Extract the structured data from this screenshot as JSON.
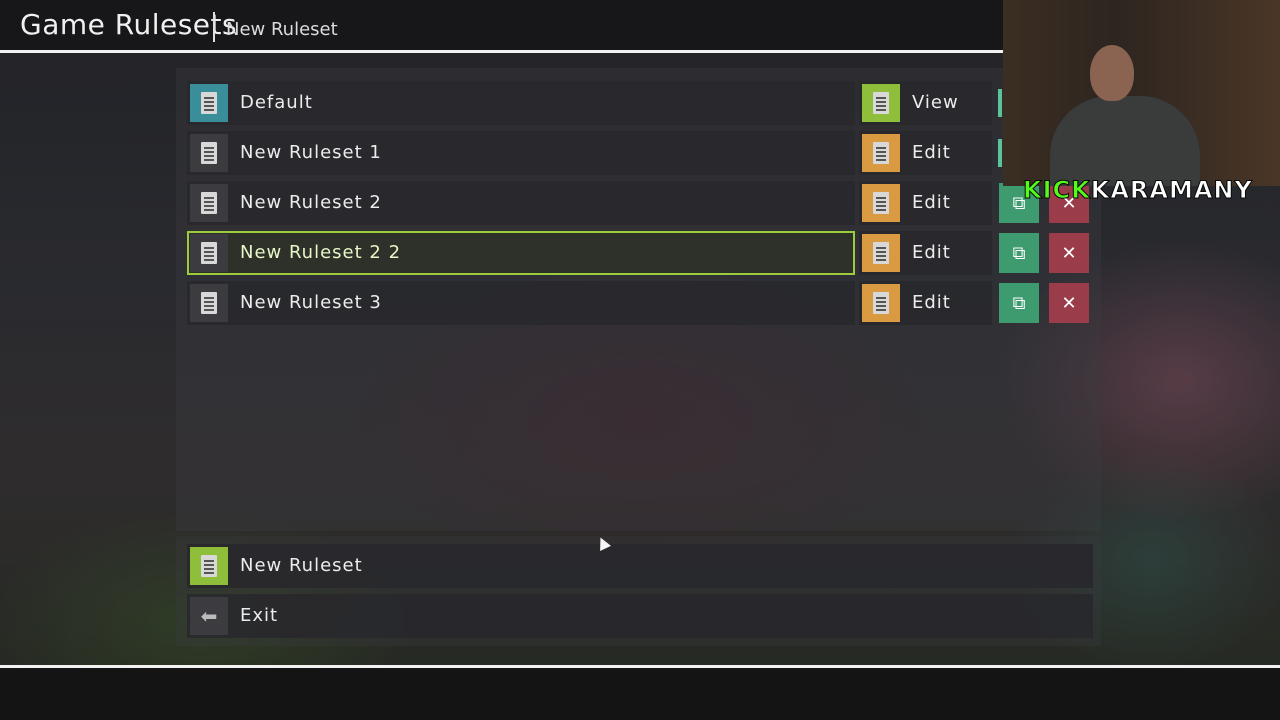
{
  "header": {
    "title": "Game Rulesets",
    "subtitle": "New Ruleset"
  },
  "rulesets": [
    {
      "name": "Default",
      "action": "View",
      "icon": "document-icon",
      "action_icon": "view-document-icon"
    },
    {
      "name": "New Ruleset 1",
      "action": "Edit",
      "icon": "document-icon",
      "action_icon": "edit-document-icon"
    },
    {
      "name": "New Ruleset 2",
      "action": "Edit",
      "icon": "document-icon",
      "action_icon": "edit-document-icon"
    },
    {
      "name": "New Ruleset 2 2",
      "action": "Edit",
      "icon": "document-icon",
      "action_icon": "edit-document-icon",
      "selected": true
    },
    {
      "name": "New Ruleset 3",
      "action": "Edit",
      "icon": "document-icon",
      "action_icon": "edit-document-icon"
    }
  ],
  "footer": {
    "new_ruleset": "New Ruleset",
    "exit": "Exit"
  },
  "overlay": {
    "kick": "KICK",
    "channel": "KARAMANY"
  },
  "colors": {
    "accent": "#9ccc3a",
    "view": "#8fbf3a",
    "edit": "#d99a42",
    "copy": "#3e9a6f",
    "delete": "#9a3c4a",
    "default_icon": "#3a8e9a",
    "kick": "#53fc18"
  }
}
